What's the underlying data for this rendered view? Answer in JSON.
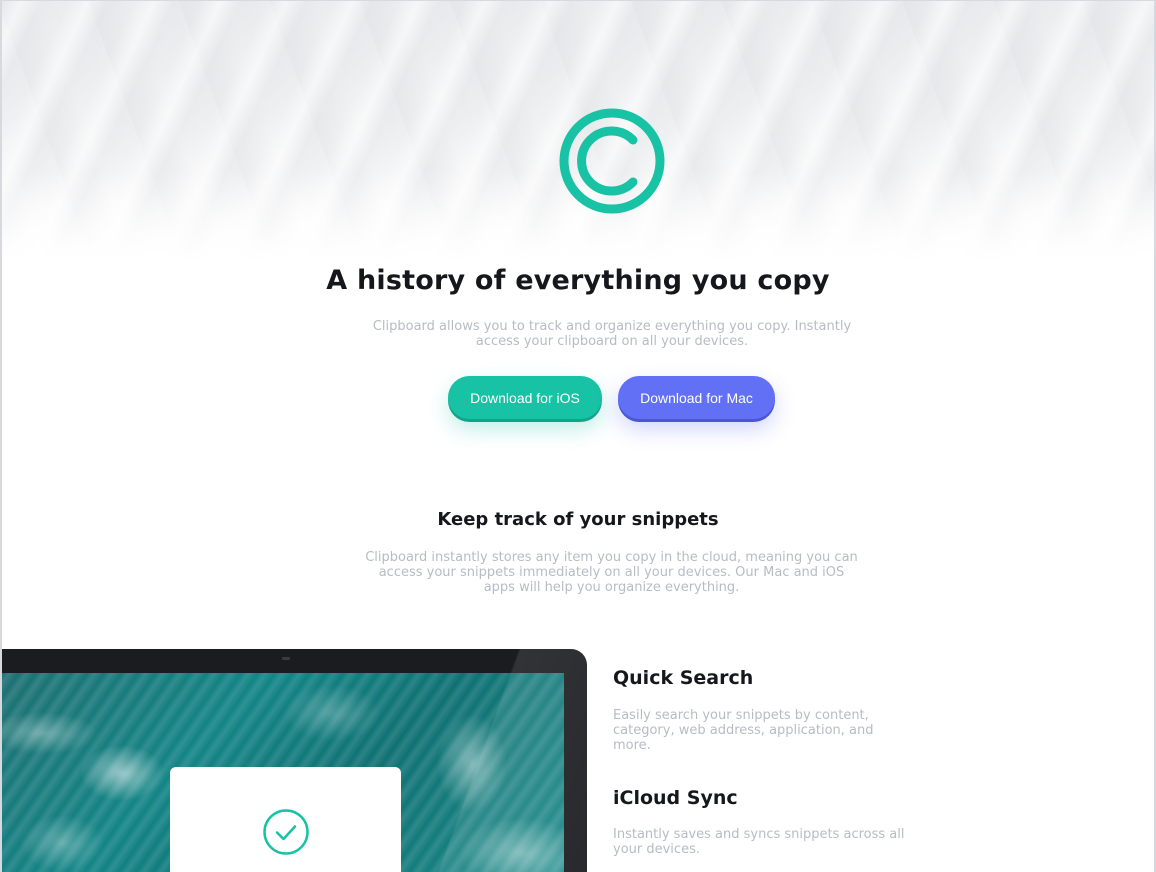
{
  "colors": {
    "accent_teal": "#18c2a4",
    "accent_blue": "#6270f6",
    "heading": "#15171c",
    "body_text": "#b7bcc4"
  },
  "hero": {
    "logo_icon": "copyright-logo-icon",
    "title": "A history of everything you copy",
    "subtitle": "Clipboard allows you to track and organize everything you copy. Instantly access your clipboard on all your devices.",
    "buttons": {
      "ios_label": "Download for iOS",
      "mac_label": "Download for Mac"
    }
  },
  "snippets": {
    "title": "Keep track of your snippets",
    "description": "Clipboard instantly stores any item you copy in the cloud, meaning you can access your snippets immediately on all your devices. Our Mac and iOS apps will help you organize everything."
  },
  "preview": {
    "check_icon": "check-circle-icon"
  },
  "features": [
    {
      "title": "Quick Search",
      "description": "Easily search your snippets by content, category, web address, application, and more."
    },
    {
      "title": "iCloud Sync",
      "description": "Instantly saves and syncs snippets across all your devices."
    }
  ]
}
